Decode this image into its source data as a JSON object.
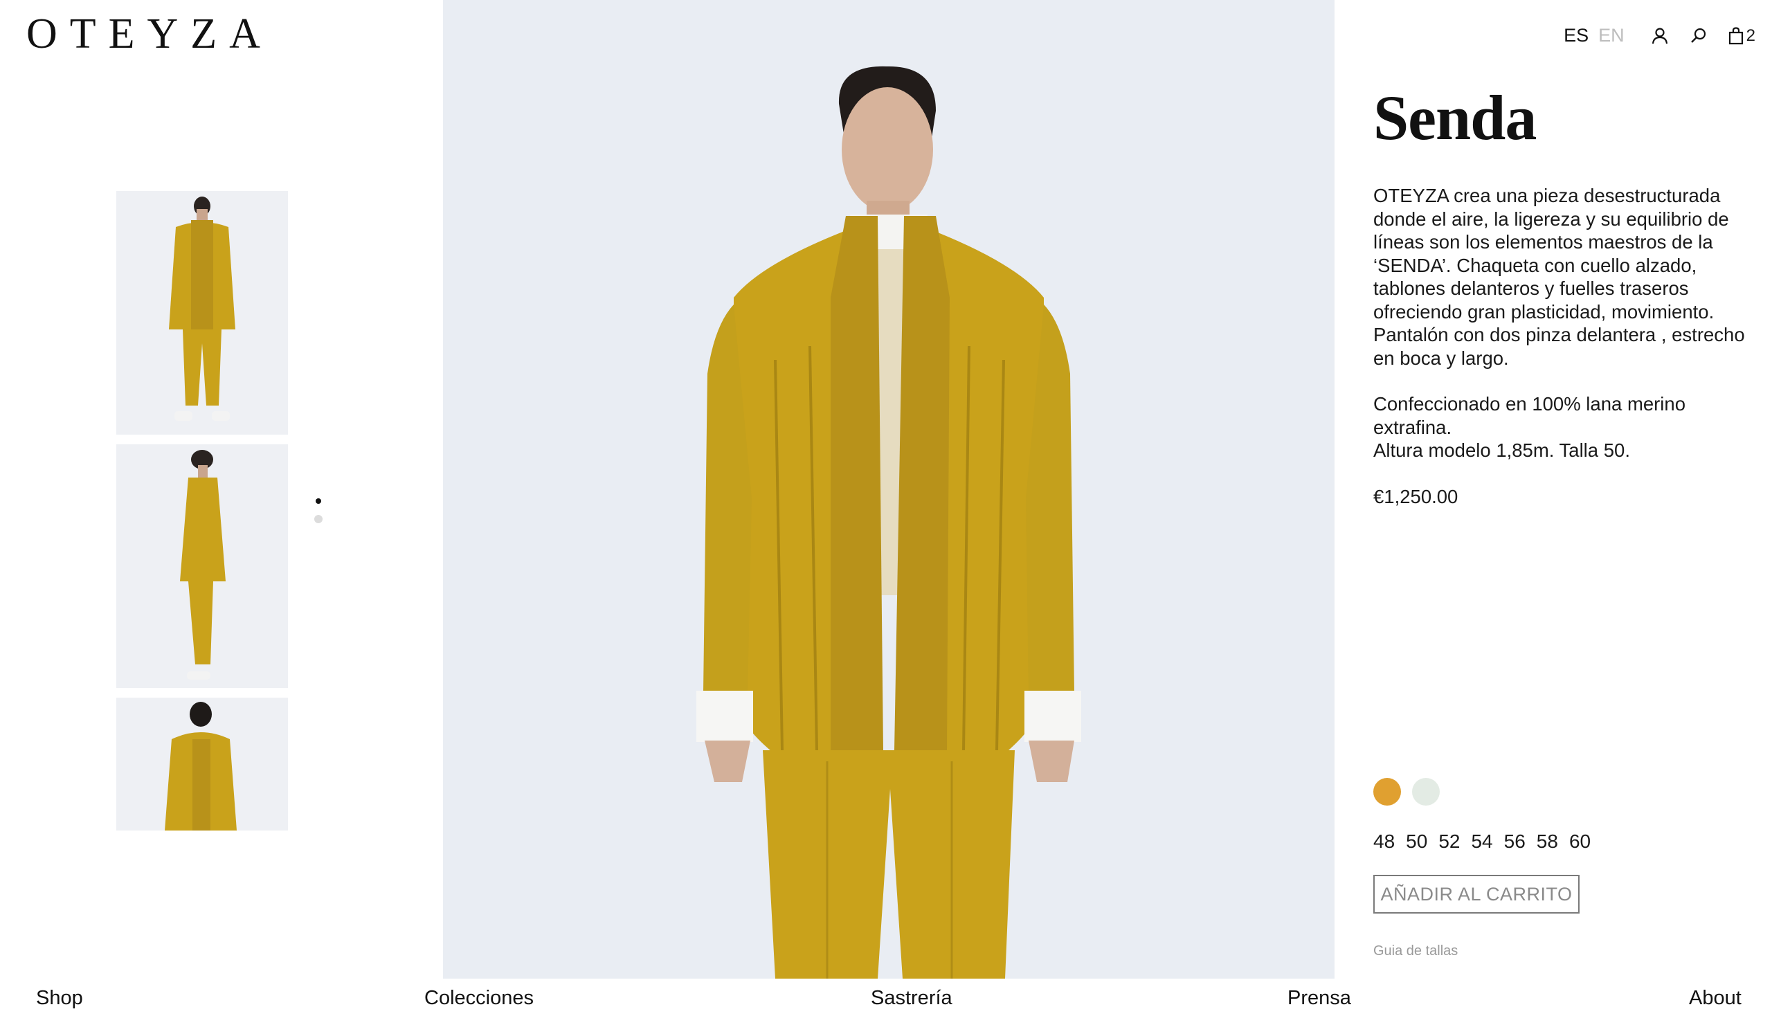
{
  "brand": {
    "logo": "OTEYZA"
  },
  "header": {
    "lang_es": "ES",
    "lang_en": "EN",
    "cart_count": "2",
    "icons": [
      "account-icon",
      "search-icon",
      "bag-icon"
    ]
  },
  "gallery": {
    "thumbnails": [
      {
        "icon": "front-view-thumbnail"
      },
      {
        "icon": "side-view-thumbnail"
      },
      {
        "icon": "back-view-thumbnail"
      }
    ],
    "dots": {
      "count": 2,
      "active_index": 0
    }
  },
  "product": {
    "title": "Senda",
    "description": [
      "OTEYZA crea una pieza desestructurada donde el aire, la ligereza y su equilibrio de líneas son los elementos maestros de la ‘SENDA’. Chaqueta con cuello alzado, tablones delanteros y fuelles traseros ofreciendo gran plasticidad, movimiento. Pantalón con dos pinza delantera , estrecho en boca y largo.",
      "Confeccionado en 100% lana merino extrafina.\nAltura modelo 1,85m. Talla 50."
    ],
    "price": "€1,250.00",
    "colors": [
      "#e0a030",
      "#e3ebe4"
    ],
    "sizes": [
      "48",
      "50",
      "52",
      "54",
      "56",
      "58",
      "60"
    ],
    "add_to_cart": "AÑADIR AL CARRITO",
    "size_guide": "Guia de tallas"
  },
  "footer": {
    "links": [
      "Shop",
      "Colecciones",
      "Sastrería",
      "Prensa",
      "About"
    ]
  },
  "colors": {
    "garment": "#c9a21b",
    "background_photo": "#e9edf3"
  }
}
